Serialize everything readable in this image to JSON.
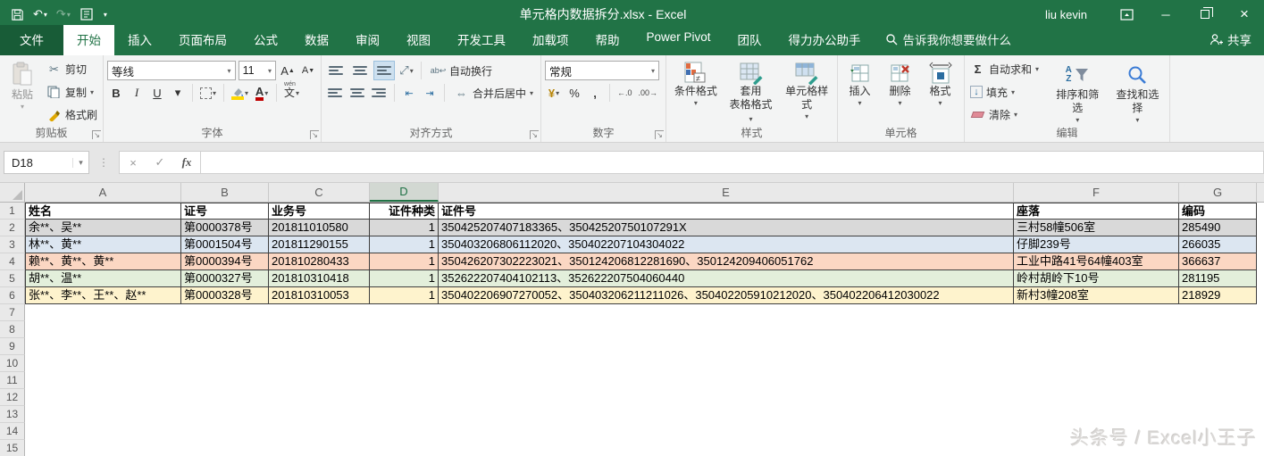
{
  "titlebar": {
    "title": "单元格内数据拆分.xlsx  -  Excel",
    "user": "liu kevin"
  },
  "tabs": {
    "file": "文件",
    "items": [
      "开始",
      "插入",
      "页面布局",
      "公式",
      "数据",
      "审阅",
      "视图",
      "开发工具",
      "加载项",
      "帮助",
      "Power Pivot",
      "团队",
      "得力办公助手"
    ],
    "active": "开始",
    "search_placeholder": "告诉我你想要做什么",
    "share": "共享"
  },
  "ribbon": {
    "clipboard": {
      "label": "剪贴板",
      "paste": "粘贴",
      "cut": "剪切",
      "copy": "复制",
      "format_painter": "格式刷"
    },
    "font": {
      "label": "字体",
      "font_name": "等线",
      "font_size": "11",
      "bold": "B",
      "italic": "I",
      "underline": "U",
      "grow": "A",
      "shrink": "A",
      "color_letter": "A",
      "phonetic": "文",
      "phonetic_pinyin": "wén"
    },
    "alignment": {
      "label": "对齐方式",
      "wrap_text": "自动换行",
      "merge_center": "合并后居中"
    },
    "number": {
      "label": "数字",
      "format": "常规",
      "currency": "¥",
      "percent": "%",
      "comma": ",",
      "inc_decimal": "←.0",
      "dec_decimal": ".00→"
    },
    "styles": {
      "label": "样式",
      "conditional": "条件格式",
      "format_table_1": "套用",
      "format_table_2": "表格格式",
      "cell_styles": "单元格样式"
    },
    "cells": {
      "label": "单元格",
      "insert": "插入",
      "delete": "删除",
      "format": "格式"
    },
    "editing": {
      "label": "编辑",
      "autosum": "自动求和",
      "fill": "填充",
      "clear": "清除",
      "sort_filter": "排序和筛选",
      "find_select": "查找和选择",
      "sum_glyph": "Σ",
      "fill_glyph": "↓",
      "sort_a": "A",
      "sort_z": "Z"
    }
  },
  "formula_bar": {
    "name_box": "D18",
    "formula_value": ""
  },
  "icons": {
    "cut": "✂",
    "caret": "▾",
    "undo": "↶",
    "redo": "↷",
    "close": "×",
    "minimize": "─",
    "check": "✓",
    "cancel": "×",
    "fx": "fx",
    "dots": "⋮",
    "merge": "⇔",
    "orientation": "⤢",
    "wrap": "ab↩"
  },
  "sheet": {
    "columns": [
      "A",
      "B",
      "C",
      "D",
      "E",
      "F",
      "G"
    ],
    "selected_column": "D",
    "header_row_number": 1,
    "header_cells": [
      "姓名",
      "证号",
      "业务号",
      "证件种类",
      "证件号",
      "座落",
      "编码"
    ],
    "rows": [
      {
        "n": 2,
        "fill": "#d9d9d9",
        "cells": [
          "余**、吴**",
          "第0000378号",
          "201811010580",
          "1",
          "350425207407183365、35042520750107291X",
          "三村58幢506室",
          "285490"
        ]
      },
      {
        "n": 3,
        "fill": "#dce6f1",
        "cells": [
          "林**、黄**",
          "第0001504号",
          "201811290155",
          "1",
          "350403206806112020、350402207104304022",
          "仔脚239号",
          "266035"
        ]
      },
      {
        "n": 4,
        "fill": "#fbd7c3",
        "cells": [
          "赖**、黄**、黄**",
          "第0000394号",
          "201810280433",
          "1",
          "350426207302223021、350124206812281690、350124209406051762",
          "工业中路41号64幢403室",
          "366637"
        ]
      },
      {
        "n": 5,
        "fill": "#e3efdb",
        "cells": [
          "胡**、温**",
          "第0000327号",
          "201810310418",
          "1",
          "352622207404102113、352622207504060440",
          "岭村胡岭下10号",
          "281195"
        ]
      },
      {
        "n": 6,
        "fill": "#fef3cd",
        "cells": [
          "张**、李**、王**、赵**",
          "第0000328号",
          "201810310053",
          "1",
          "350402206907270052、350403206211211026、350402205910212020、350402206412030022",
          "新村3幢208室",
          "218929"
        ]
      }
    ],
    "empty_row_numbers": [
      7,
      8,
      9,
      10,
      11,
      12,
      13,
      14,
      15
    ]
  },
  "watermark": "头条号 / Excel小王子",
  "colors": {
    "excel_green": "#217346",
    "selected_header_text": "#1e7145"
  }
}
